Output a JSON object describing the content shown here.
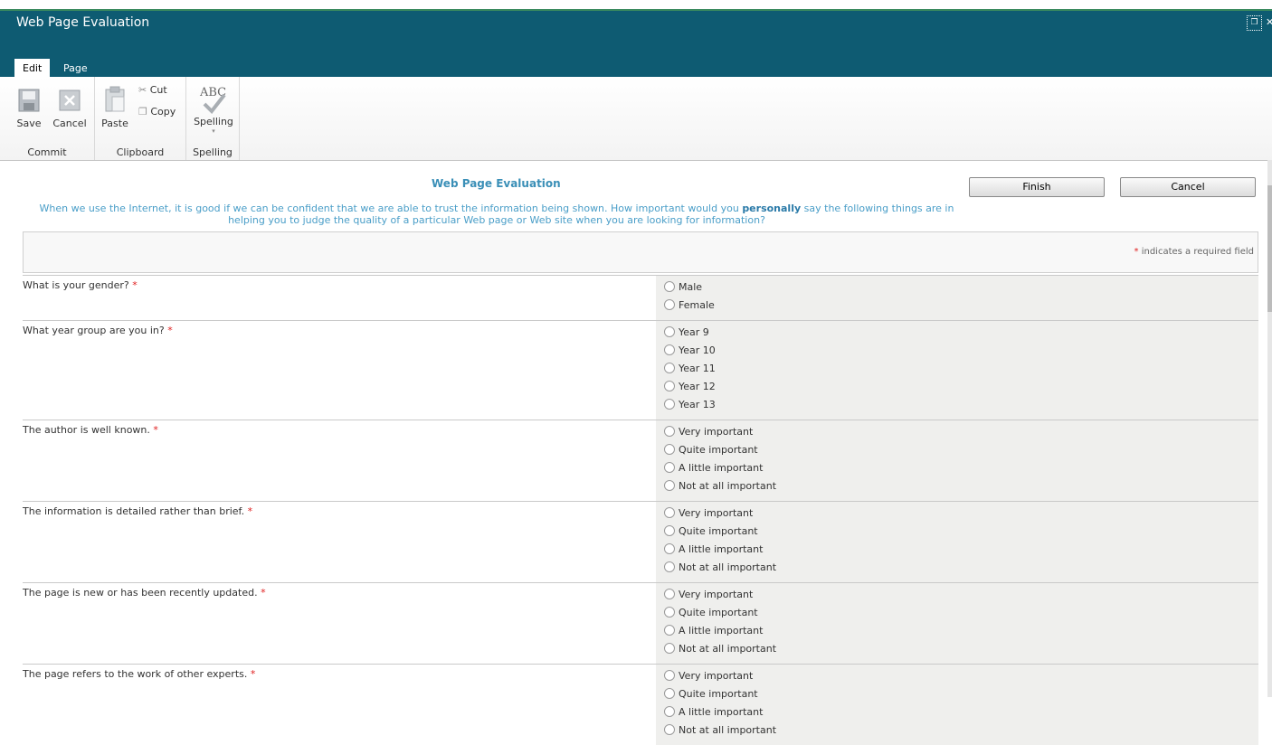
{
  "window": {
    "title": "Web Page Evaluation"
  },
  "tabs": [
    {
      "label": "Edit"
    },
    {
      "label": "Page"
    }
  ],
  "ribbon": {
    "commit": {
      "label": "Commit",
      "save": "Save",
      "cancel": "Cancel"
    },
    "clipboard": {
      "label": "Clipboard",
      "paste": "Paste",
      "cut": "Cut",
      "copy": "Copy"
    },
    "spelling": {
      "label": "Spelling",
      "button": "Spelling",
      "icon_text": "ABC"
    }
  },
  "form": {
    "title": "Web Page Evaluation",
    "intro_before": "When we use the Internet, it is good if we can be confident that we are able to trust the information being shown. How important would you ",
    "intro_bold": "personally",
    "intro_after": " say the following things are in helping you to judge the quality of a particular Web page or Web site when you are looking for information?",
    "finish_label": "Finish",
    "cancel_label": "Cancel",
    "required_note": "indicates a required field",
    "required_star": "*",
    "questions": [
      {
        "text": "What is your gender?",
        "options": [
          "Male",
          "Female"
        ]
      },
      {
        "text": "What year group are you in?",
        "options": [
          "Year 9",
          "Year 10",
          "Year 11",
          "Year 12",
          "Year 13"
        ]
      },
      {
        "text": "The author is well known.",
        "options": [
          "Very important",
          "Quite important",
          "A little important",
          "Not at all important"
        ]
      },
      {
        "text": "The information is detailed rather than brief.",
        "options": [
          "Very important",
          "Quite important",
          "A little important",
          "Not at all important"
        ]
      },
      {
        "text": "The page is new or has been recently updated.",
        "options": [
          "Very important",
          "Quite important",
          "A little important",
          "Not at all important"
        ]
      },
      {
        "text": "The page refers to the work of other experts.",
        "options": [
          "Very important",
          "Quite important",
          "A little important",
          "Not at all important"
        ]
      }
    ]
  },
  "colors": {
    "titlebar": "#0e5b72",
    "accent": "#3a8fb7",
    "required": "#e02020"
  }
}
